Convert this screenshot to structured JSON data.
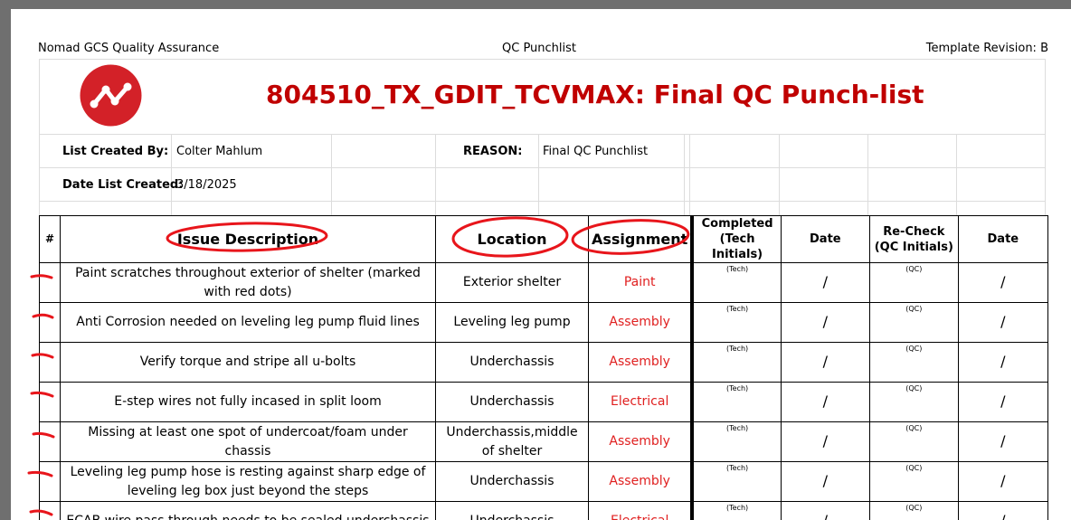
{
  "header": {
    "left": "Nomad GCS Quality Assurance",
    "center": "QC Punchlist",
    "right": "Template Revision: B"
  },
  "title": "804510_TX_GDIT_TCVMAX: Final QC Punch-list",
  "logo": {
    "icon": "graph-nodes-logo",
    "color": "#d32128"
  },
  "info": {
    "created_by_label": "List Created By:",
    "created_by": "Colter Mahlum",
    "reason_label": "REASON:",
    "reason": "Final QC Punchlist",
    "date_label": "Date List Created:",
    "date": "3/18/2025"
  },
  "columns": {
    "num": "#",
    "issue": "Issue Description",
    "location": "Location",
    "assignment": "Assignment",
    "completed_1": "Completed",
    "completed_2": "(Tech Initials)",
    "date": "Date",
    "recheck_1": "Re-Check",
    "recheck_2": "(QC Initials)",
    "date2": "Date"
  },
  "tech_tag": "(Tech)",
  "qc_tag": "(QC)",
  "slash": "/",
  "rows": [
    {
      "issue": "Paint scratches throughout exterior of shelter (marked with red dots)",
      "location": "Exterior shelter",
      "assignment": "Paint"
    },
    {
      "issue": "Anti Corrosion needed on leveling leg pump fluid lines",
      "location": "Leveling leg pump",
      "assignment": "Assembly"
    },
    {
      "issue": "Verify torque and stripe all u-bolts",
      "location": "Underchassis",
      "assignment": "Assembly"
    },
    {
      "issue": "E-step wires not fully incased in split loom",
      "location": "Underchassis",
      "assignment": "Electrical"
    },
    {
      "issue": "Missing at least one spot of undercoat/foam under chassis",
      "location": "Underchassis,middle of shelter",
      "assignment": "Assembly"
    },
    {
      "issue": "Leveling leg pump hose is resting against sharp edge of leveling leg box just beyond the steps",
      "location": "Underchassis",
      "assignment": "Assembly"
    },
    {
      "issue": "ECAB wire pass through needs to be sealed underchassis",
      "location": "Underchassis",
      "assignment": "Electrical"
    }
  ],
  "colors": {
    "title": "#c00000",
    "assignment": "#e02020",
    "annotation": "#e8151b"
  }
}
